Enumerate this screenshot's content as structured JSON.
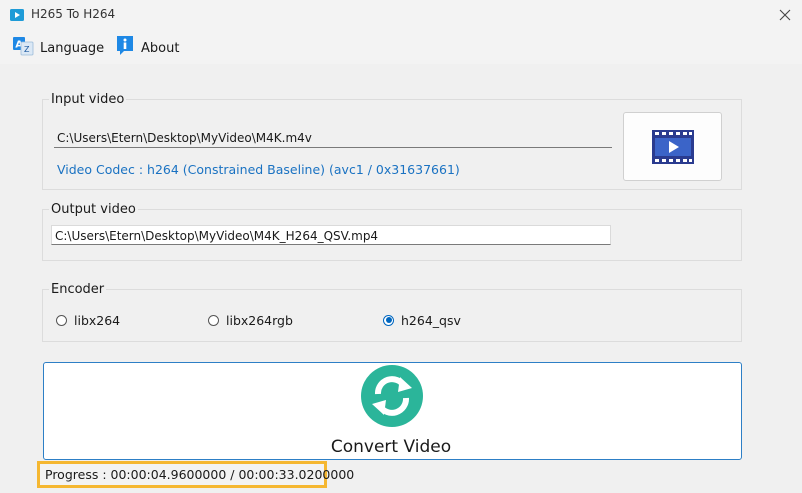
{
  "window": {
    "title": "H265 To H264"
  },
  "menu": {
    "language_label": "Language",
    "about_label": "About"
  },
  "input": {
    "group_title": "Input video",
    "path": "C:\\Users\\Etern\\Desktop\\MyVideo\\M4K.m4v",
    "codec_info": "Video Codec : h264 (Constrained Baseline) (avc1 / 0x31637661)"
  },
  "output": {
    "group_title": "Output video",
    "path": "C:\\Users\\Etern\\Desktop\\MyVideo\\M4K_H264_QSV.mp4"
  },
  "encoder": {
    "group_title": "Encoder",
    "options": [
      {
        "label": "libx264",
        "checked": false
      },
      {
        "label": "libx264rgb",
        "checked": false
      },
      {
        "label": "h264_qsv",
        "checked": true
      }
    ]
  },
  "convert": {
    "label": "Convert Video"
  },
  "progress": {
    "text": "Progress : 00:00:04.9600000 / 00:00:33.0200000"
  },
  "colors": {
    "accent": "#0067c0",
    "codec_text": "#1a72c2",
    "convert_icon": "#2bb59a",
    "highlight": "#f5b731"
  }
}
